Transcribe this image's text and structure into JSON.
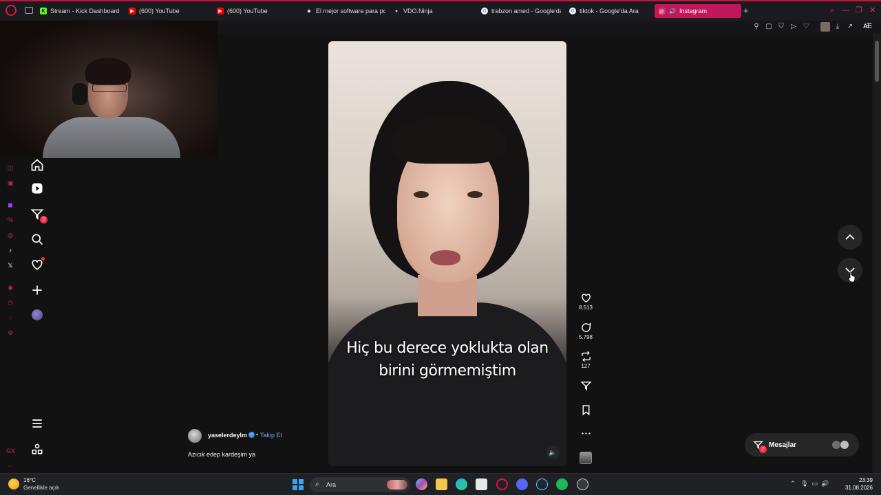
{
  "browser": {
    "tabs": [
      {
        "label": "Stream - Kick Dashboard",
        "icon": "kick-icon",
        "color": "#53fc18",
        "fav": "K"
      },
      {
        "label": "(600) YouTube",
        "icon": "youtube-icon",
        "color": "#ff0000",
        "fav": "▶"
      },
      {
        "label": "(600) YouTube",
        "icon": "youtube-icon",
        "color": "#ff0000",
        "fav": "▶"
      },
      {
        "label": "El mejor software para pol...",
        "icon": "diamond-icon",
        "color": "#dddddd",
        "fav": "◆"
      },
      {
        "label": "VDO.Ninja",
        "icon": "ninja-icon",
        "color": "#cccccc",
        "fav": "●"
      },
      {
        "label": "trabzon amed - Google'da",
        "icon": "google-icon",
        "color": "#ffffff",
        "fav": "G"
      },
      {
        "label": "tiktok - Google'da Ara",
        "icon": "google-icon",
        "color": "#ffffff",
        "fav": "G"
      },
      {
        "label": "Instagram",
        "icon": "instagram-icon",
        "color": "#e1306c",
        "fav": "◎",
        "active": true
      }
    ],
    "new_tab": "+",
    "toolbar_ai": "AI",
    "accent": "#c4143a"
  },
  "instagram": {
    "nav_badges": {
      "reels_messages": "2"
    },
    "reel": {
      "caption_line1": "Hiç bu derece yoklukta olan",
      "caption_line2": "birini görmemiştim"
    },
    "actions": {
      "likes": "8.513",
      "comments": "5.798",
      "reposts": "127"
    },
    "author": {
      "username": "yaselerdeylm",
      "separator": "•",
      "follow": "Takip Et",
      "caption": "Azıcık edep kardeşim ya"
    },
    "messages": {
      "label": "Mesajlar",
      "badge": "2"
    }
  },
  "taskbar": {
    "weather_temp": "16°C",
    "weather_desc": "Genellikle açık",
    "search_label": "Ara",
    "time": "23:39",
    "date": "31.08.2026"
  }
}
